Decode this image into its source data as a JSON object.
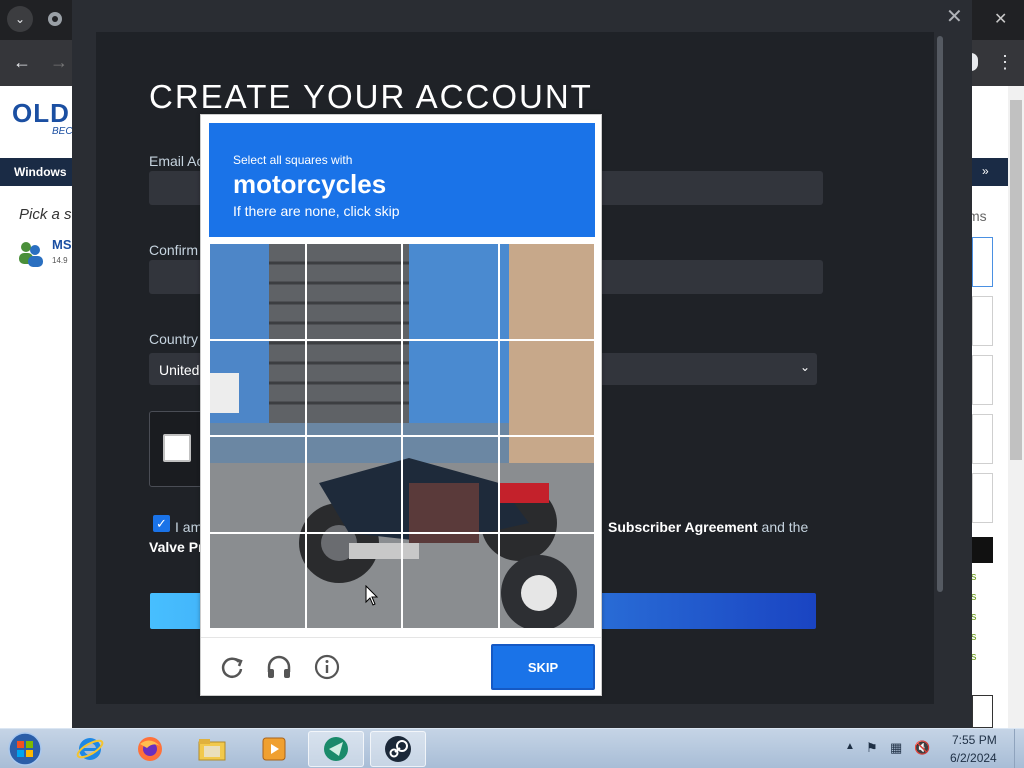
{
  "browser": {
    "tab_dropdown_glyph": "⌄",
    "back_glyph": "←",
    "forward_glyph": "→",
    "menu_glyph": "⋮"
  },
  "site": {
    "logo": "OLD",
    "logo_sub": "BEC",
    "nav_item": "Windows",
    "nav_chevron": "»",
    "pick_text": "Pick a s",
    "user_title": "MS",
    "user_sub": "14.9",
    "right_fragment": "ms",
    "green_links": [
      "s",
      "s",
      "s",
      "s",
      "s"
    ]
  },
  "overlay": {
    "close_glyph": "✕",
    "window_close_glyph": "✕"
  },
  "form": {
    "title": "CREATE YOUR ACCOUNT",
    "email_label": "Email Ac",
    "confirm_label": "Confirm",
    "country_label": "Country",
    "country_value": "United",
    "country_chevron": "⌄",
    "agree_prefix": "I am",
    "agree_suffix_link": "Subscriber Agreement",
    "agree_suffix_tail": " and the",
    "valve_text": "Valve Pr"
  },
  "captcha": {
    "instruction": "Select all squares with",
    "target": "motorcycles",
    "hint": "If there are none, click skip",
    "skip_label": "SKIP",
    "grid_rows": 4,
    "grid_cols": 4,
    "icons": [
      "reload-icon",
      "audio-headphones-icon",
      "info-icon"
    ]
  },
  "taskbar": {
    "time": "7:55 PM",
    "date": "6/2/2024",
    "apps": [
      "internet-explorer",
      "firefox",
      "file-explorer",
      "media-player",
      "unknown-app",
      "steam"
    ]
  },
  "colors": {
    "captcha_blue": "#1a73e8",
    "overlay_dark": "#2a2d33",
    "panel_dark": "#1f2227",
    "field_bg": "#32353c"
  }
}
